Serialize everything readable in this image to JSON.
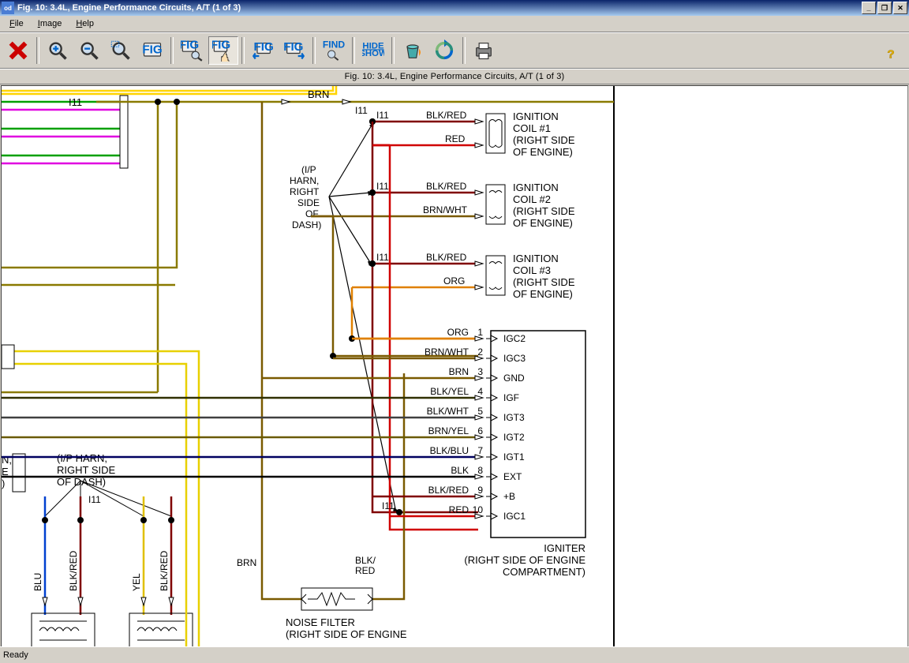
{
  "titlebar": {
    "title": "Fig. 10: 3.4L, Engine Performance Circuits, A/T (1 of 3)"
  },
  "menu": {
    "file": "File",
    "image": "Image",
    "help": "Help"
  },
  "toolbar": {
    "find": "FIND",
    "hide": "HIDE",
    "show": "SHOW"
  },
  "caption": "Fig. 10: 3.4L, Engine Performance Circuits, A/T (1 of 3)",
  "status": "Ready",
  "labels": {
    "i11": "I11",
    "brn": "BRN",
    "ipharn_label": "(I/P\nHARN,\nRIGHT\nSIDE\nOF\nDASH)",
    "ipharn_left": "(I/P HARN,\nRIGHT SIDE\nOF DASH)",
    "coil1": "IGNITION\nCOIL #1\n(RIGHT SIDE\nOF ENGINE)",
    "coil2": "IGNITION\nCOIL #2\n(RIGHT SIDE\nOF ENGINE)",
    "coil3": "IGNITION\nCOIL #3\n(RIGHT SIDE\nOF ENGINE)",
    "blkred": "BLK/RED",
    "red": "RED",
    "brnwht": "BRN/WHT",
    "org": "ORG",
    "blkyel": "BLK/YEL",
    "blkwht": "BLK/WHT",
    "brnyel": "BRN/YEL",
    "blkblu": "BLK/BLU",
    "blk": "BLK",
    "blu": "BLU",
    "yel": "YEL",
    "noise": "NOISE FILTER\n(RIGHT SIDE OF ENGINE",
    "igniter": "IGNITER\n(RIGHT SIDE OF ENGINE\nCOMPARTMENT)"
  },
  "igniter_pins": [
    {
      "n": "1",
      "w": "ORG",
      "sig": "IGC2"
    },
    {
      "n": "2",
      "w": "BRN/WHT",
      "sig": "IGC3"
    },
    {
      "n": "3",
      "w": "BRN",
      "sig": "GND"
    },
    {
      "n": "4",
      "w": "BLK/YEL",
      "sig": "IGF"
    },
    {
      "n": "5",
      "w": "BLK/WHT",
      "sig": "IGT3"
    },
    {
      "n": "6",
      "w": "BRN/YEL",
      "sig": "IGT2"
    },
    {
      "n": "7",
      "w": "BLK/BLU",
      "sig": "IGT1"
    },
    {
      "n": "8",
      "w": "BLK",
      "sig": "EXT"
    },
    {
      "n": "9",
      "w": "BLK/RED",
      "sig": "+B"
    },
    {
      "n": "10",
      "w": "RED",
      "sig": "IGC1"
    }
  ],
  "left_wires": [
    "BLU",
    "BLK/RED",
    "YEL",
    "BLK/RED"
  ],
  "blk_red_v": "BLK/\nRED"
}
